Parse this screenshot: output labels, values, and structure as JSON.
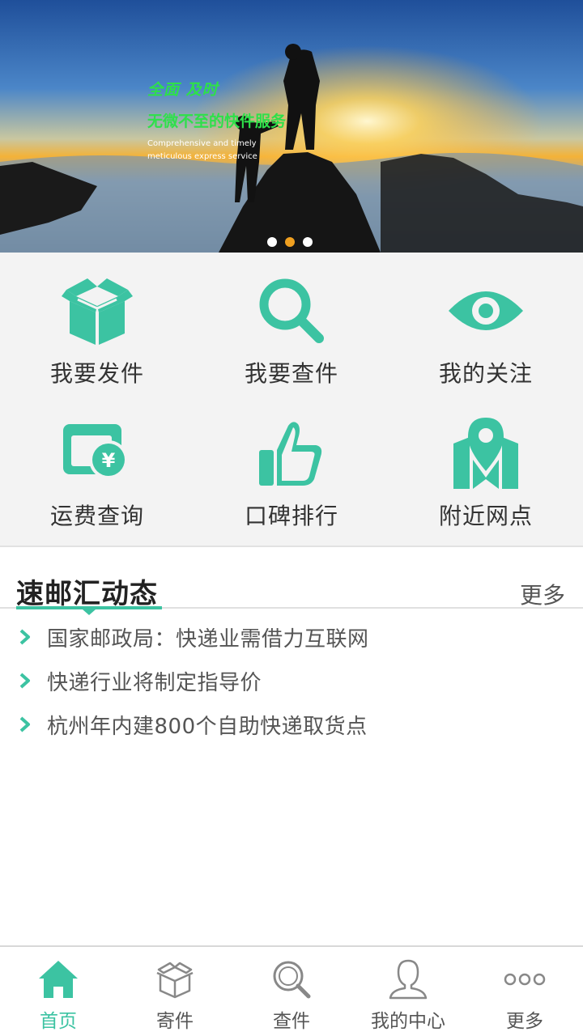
{
  "banner": {
    "headline_1": "全面 及时",
    "headline_2": "无微不至的快件服务",
    "tagline": "Comprehensive and timely meticulous express service",
    "slide_count": 3,
    "active_slide": 2
  },
  "features": [
    {
      "label": "我要发件",
      "icon": "box-icon"
    },
    {
      "label": "我要查件",
      "icon": "search-icon"
    },
    {
      "label": "我的关注",
      "icon": "eye-icon"
    },
    {
      "label": "运费查询",
      "icon": "fee-card-icon"
    },
    {
      "label": "口碑排行",
      "icon": "thumbs-up-icon"
    },
    {
      "label": "附近网点",
      "icon": "map-pin-icon"
    }
  ],
  "news": {
    "title": "速邮汇动态",
    "more_label": "更多",
    "items": [
      "国家邮政局：快递业需借力互联网",
      "快递行业将制定指导价",
      "杭州年内建800个自助快递取货点"
    ]
  },
  "tabs": [
    {
      "label": "首页",
      "icon": "home-icon",
      "active": true
    },
    {
      "label": "寄件",
      "icon": "box-outline-icon",
      "active": false
    },
    {
      "label": "查件",
      "icon": "search-outline-icon",
      "active": false
    },
    {
      "label": "我的中心",
      "icon": "user-icon",
      "active": false
    },
    {
      "label": "更多",
      "icon": "more-dots-icon",
      "active": false
    }
  ],
  "colors": {
    "accent": "#3cc3a2",
    "dot_active": "#f0a020",
    "text": "#333333",
    "grid_bg": "#f3f3f3"
  }
}
